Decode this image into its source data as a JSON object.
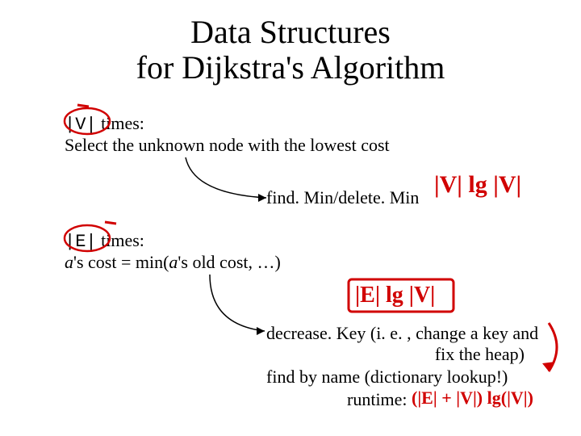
{
  "title_line1": "Data Structures",
  "title_line2": "for Dijkstra's Algorithm",
  "section1": {
    "count_token": "|V|",
    "count_suffix": " times:",
    "desc": "Select the unknown node with the lowest cost"
  },
  "op1": "find. Min/delete. Min",
  "section2": {
    "count_token": "|E|",
    "count_suffix": " times:",
    "desc_prefix": "a",
    "desc_mid1": "'s cost = min(",
    "desc_a2": "a",
    "desc_mid2": "'s old cost, …)"
  },
  "op2_line1": "decrease. Key (i. e. , change a key and",
  "op2_line2": "fix the heap)",
  "op3": "find by name (dictionary lookup!)",
  "runtime_label": "runtime:",
  "hand": {
    "vlgv": "|V| lg |V|",
    "elgv": "|E| lg |V|",
    "runtime": "(|E| + |V|) lg(|V|)"
  }
}
